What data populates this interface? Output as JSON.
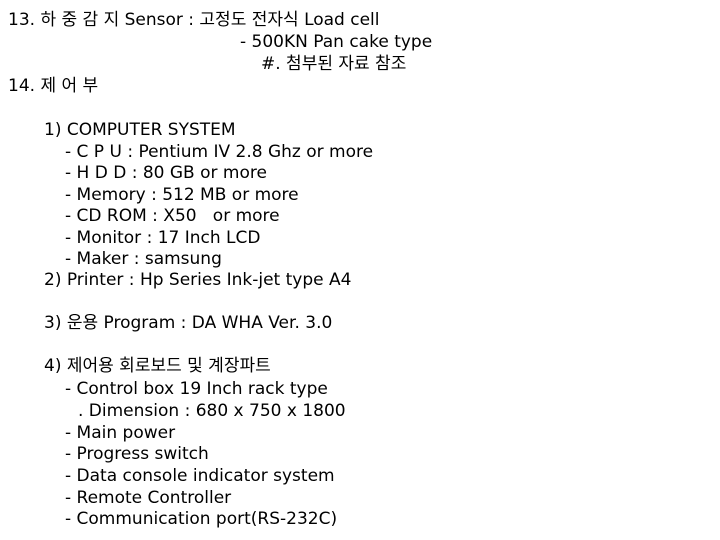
{
  "document": {
    "background_color": "#ffffff",
    "text_color": "#000000",
    "sections": [
      {
        "number": "13",
        "heading": "13. 하 중 감 지 Sensor : 고정도 전자식 Load cell",
        "continuation_1": "- 500KN Pan cake type",
        "continuation_2": "#. 첨부된 자료 참조"
      },
      {
        "number": "14",
        "heading": "14. 제 어 부",
        "items": [
          {
            "label": "1) COMPUTER SYSTEM",
            "subitems": [
              "- C P U : Pentium IV 2.8 Ghz or more",
              "- H D D : 80 GB or more",
              "- Memory : 512 MB or more",
              "- CD ROM : X50   or more",
              "- Monitor : 17 Inch LCD",
              "- Maker : samsung"
            ]
          },
          {
            "label": "2) Printer : Hp Series Ink-jet type A4",
            "subitems": []
          },
          {
            "label": "3) 운용 Program : DA WHA Ver. 3.0",
            "subitems": []
          },
          {
            "label": "4) 제어용 회로보드 및 계장파트",
            "subitems": [
              "- Control box 19 Inch rack type",
              ". Dimension : 680 x 750 x 1800",
              "- Main power",
              "- Progress switch",
              "- Data console indicator system",
              "- Remote Controller",
              "- Communication port(RS-232C)"
            ]
          }
        ]
      }
    ]
  }
}
